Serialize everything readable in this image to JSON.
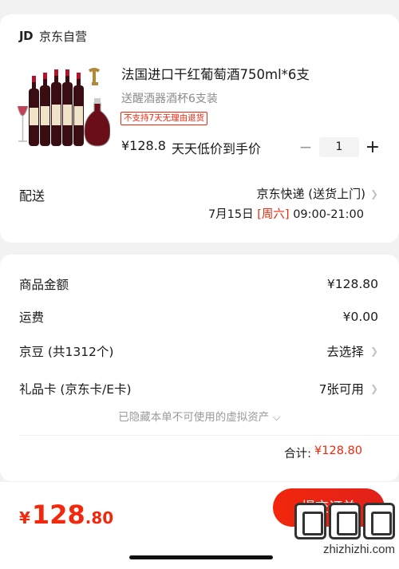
{
  "store": {
    "logo": "JD",
    "name": "京东自营"
  },
  "product": {
    "title": "法国进口干红葡萄酒750ml*6支",
    "subtitle": "送醒酒器酒杯6支装",
    "tag": "不支持7天无理由退货",
    "price": "¥128.8",
    "price_note": "天天低价到手价",
    "quantity": "1"
  },
  "delivery": {
    "label": "配送",
    "method": "京东快递 (送货上门)",
    "date": "7月15日",
    "weekday": "[周六]",
    "time": "09:00-21:00"
  },
  "summary": {
    "rows": [
      {
        "label": "商品金额",
        "value": "¥128.80"
      },
      {
        "label": "运费",
        "value": "¥0.00"
      },
      {
        "label": "京豆 (共1312个)",
        "value": "去选择"
      },
      {
        "label": "礼品卡 (京东卡/E卡)",
        "value": "7张可用"
      }
    ],
    "hidden_note": "已隐藏本单不可使用的虚拟资产 ⌵",
    "total_label": "合计:",
    "total_value": "¥128.80"
  },
  "bottom": {
    "currency": "¥",
    "price_int": "128",
    "price_dec": ".80",
    "submit_label": "提交订单"
  },
  "watermark": {
    "text": "zhizhizhi.com"
  },
  "colors": {
    "accent": "#f2270c",
    "muted": "#8c8c8c"
  },
  "icons": {
    "chevron": "chevron-right-icon",
    "minus": "minus-icon",
    "plus": "plus-icon"
  }
}
